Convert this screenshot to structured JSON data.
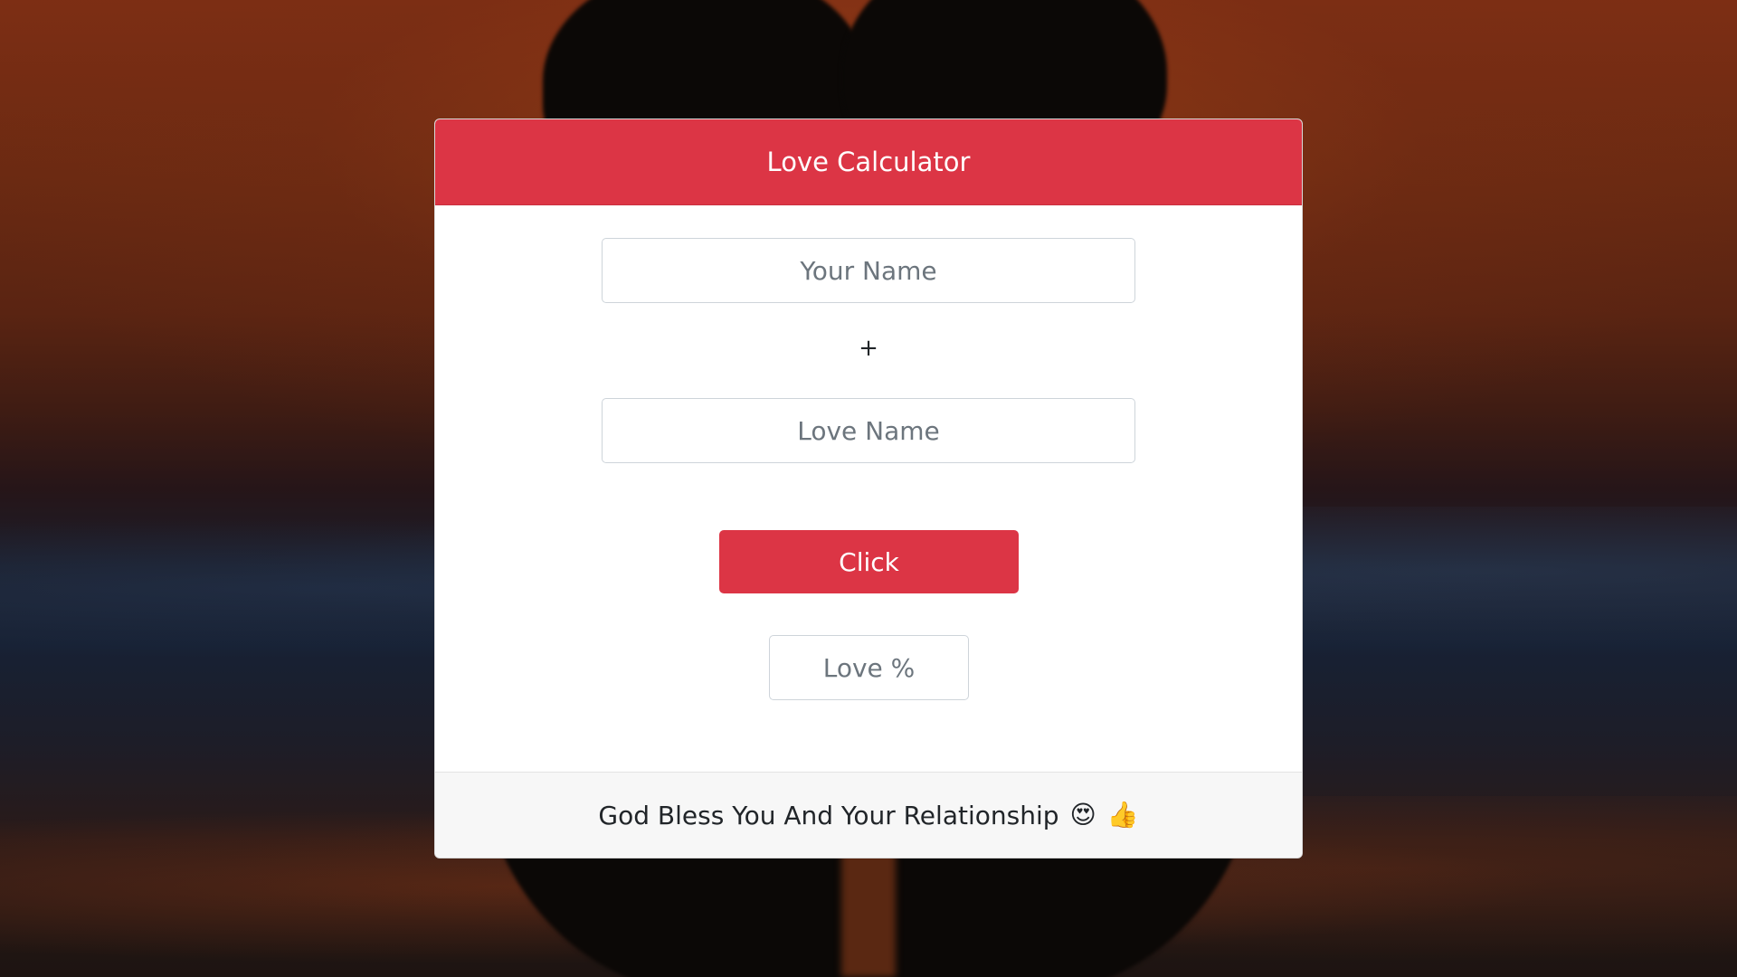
{
  "card": {
    "title": "Love Calculator",
    "your_name_placeholder": "Your Name",
    "plus": "+",
    "love_name_placeholder": "Love Name",
    "button_label": "Click",
    "result_placeholder": "Love %",
    "footer_text": "God Bless You And Your Relationship",
    "footer_emojis": [
      "😍",
      "👍"
    ],
    "footer_emoji_names": [
      "heart-eyes-icon",
      "thumbs-up-icon"
    ]
  },
  "colors": {
    "accent": "#dc3545",
    "footer_bg": "#f7f7f7"
  }
}
